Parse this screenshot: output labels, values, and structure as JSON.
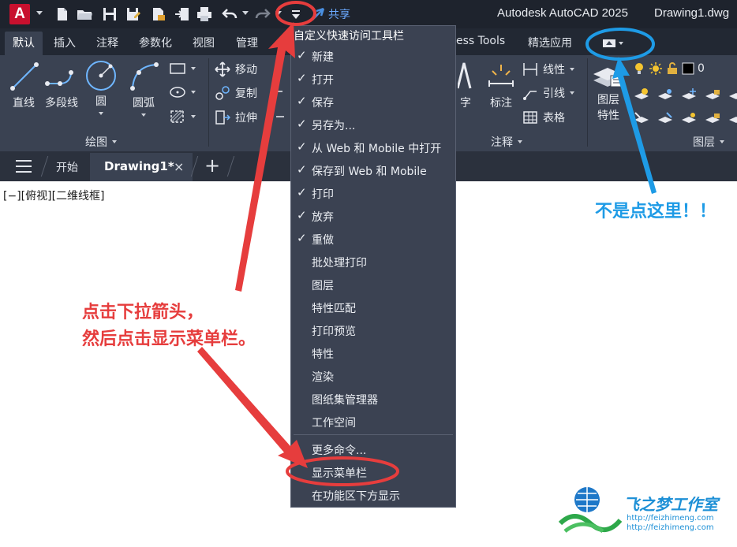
{
  "app": {
    "logo_letter": "A",
    "title": "Autodesk AutoCAD 2025",
    "document": "Drawing1.dwg",
    "share_label": "共享"
  },
  "ribbon_tabs": [
    {
      "label": "默认",
      "active": true
    },
    {
      "label": "插入"
    },
    {
      "label": "注释"
    },
    {
      "label": "参数化"
    },
    {
      "label": "视图"
    },
    {
      "label": "管理"
    },
    {
      "label": "ess Tools"
    },
    {
      "label": "精选应用"
    }
  ],
  "panels": {
    "draw": {
      "title": "绘图",
      "tools": [
        "直线",
        "多段线",
        "圆",
        "圆弧"
      ]
    },
    "modify": {
      "tools": [
        "移动",
        "复制",
        "拉伸"
      ]
    },
    "annotation": {
      "title": "注释",
      "tools": [
        "字",
        "标注",
        "线性",
        "引线",
        "表格"
      ]
    },
    "layers": {
      "title": "图层",
      "layer_properties_line1": "图层",
      "layer_properties_line2": "特性",
      "current_layer": "0"
    }
  },
  "file_tabs": {
    "start": "开始",
    "active": "Drawing1*",
    "close_icon": "×",
    "new_tab": "+"
  },
  "viewport_label": "[−][俯视][二维线框]",
  "qa_menu": {
    "title": "自定义快速访问工具栏",
    "checked_items": [
      "新建",
      "打开",
      "保存",
      "另存为...",
      "从 Web 和 Mobile 中打开",
      "保存到 Web 和 Mobile",
      "打印",
      "放弃",
      "重做"
    ],
    "unchecked_items": [
      "批处理打印",
      "图层",
      "特性匹配",
      "打印预览",
      "特性",
      "渲染",
      "图纸集管理器",
      "工作空间"
    ],
    "more_commands": "更多命令...",
    "show_menu_bar": "显示菜单栏",
    "show_below_ribbon": "在功能区下方显示"
  },
  "annotations": {
    "red_line1": "点击下拉箭头，",
    "red_line2": "然后点击显示菜单栏。",
    "blue": "不是点这里！！"
  },
  "watermark": {
    "brand": "飞之梦工作室",
    "url1": "http://feizhimeng.com",
    "url2": "http://feizhimeng.com"
  },
  "colors": {
    "titlebar": "#1e232d",
    "ribbon": "#3a4252",
    "menu": "#3b4252",
    "annotation_red": "#e63d3d",
    "annotation_blue": "#1e9be6"
  }
}
